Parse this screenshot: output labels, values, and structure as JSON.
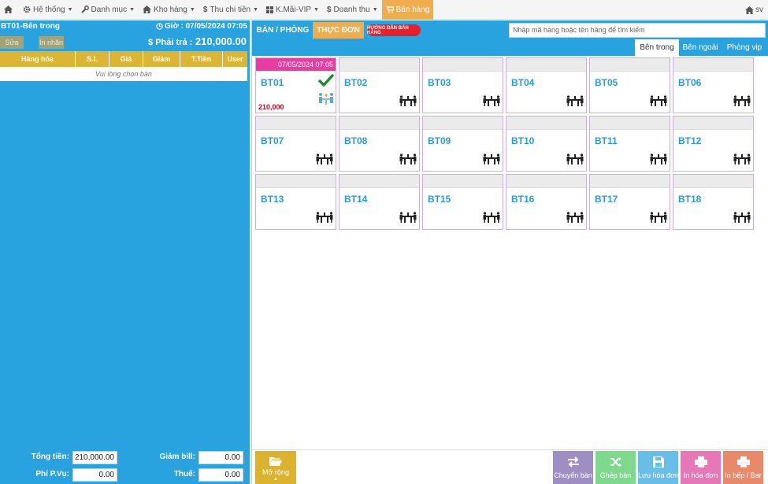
{
  "nav": {
    "home": "",
    "items": [
      {
        "label": "Hệ thống",
        "icon": "gear-icon"
      },
      {
        "label": "Danh mục",
        "icon": "wrench-icon"
      },
      {
        "label": "Kho hàng",
        "icon": "home-icon"
      },
      {
        "label": "Thu chi tiền",
        "icon": "dollar-icon"
      },
      {
        "label": "K.Mãi-VIP",
        "icon": "grid-icon"
      },
      {
        "label": "Doanh thu",
        "icon": "dollar-icon"
      }
    ],
    "active": "Bán hàng",
    "user": "sv"
  },
  "left": {
    "table_name": "BT01-Bên trong",
    "time_label": "Giờ : 07/05/2024 07:05",
    "btn_edit": "Sửa",
    "btn_print_label": "In nhãn",
    "pay_label": "$ Phải trả :",
    "pay_value": "210,000.00",
    "columns": [
      "Hàng hóa",
      "S.L",
      "Giá",
      "Giảm",
      "T.Tiền",
      "User"
    ],
    "empty_msg": "Vui lòng chọn bàn",
    "totals": {
      "total_label": "Tổng tiền:",
      "total_value": "210,000.00",
      "discount_label": "Giảm bill:",
      "discount_value": "0.00",
      "fee_label": "Phí P.Vụ:",
      "fee_value": "0.00",
      "tax_label": "Thuế:",
      "tax_value": "0.00"
    }
  },
  "right": {
    "tabs": {
      "tables": "BÀN / PHÒNG",
      "menu": "THỰC ĐƠN",
      "guide": "HƯỚNG DẪN BÁN HÀNG"
    },
    "search_placeholder": "Nhập mã hàng hoặc tên hàng để tìm kiếm",
    "areas": [
      "Bên trong",
      "Bên ngoài",
      "Phòng vip"
    ],
    "active_area": "Bên trong",
    "tables": [
      {
        "name": "BT01",
        "busy": true,
        "time": "07/05/2024 07:05",
        "amount": "210,000"
      },
      {
        "name": "BT02"
      },
      {
        "name": "BT03"
      },
      {
        "name": "BT04"
      },
      {
        "name": "BT05"
      },
      {
        "name": "BT06"
      },
      {
        "name": "BT07"
      },
      {
        "name": "BT08"
      },
      {
        "name": "BT09"
      },
      {
        "name": "BT10"
      },
      {
        "name": "BT11"
      },
      {
        "name": "BT12"
      },
      {
        "name": "BT13"
      },
      {
        "name": "BT14"
      },
      {
        "name": "BT15"
      },
      {
        "name": "BT16"
      },
      {
        "name": "BT17"
      },
      {
        "name": "BT18"
      }
    ]
  },
  "toolbar": {
    "expand": "Mở rộng",
    "actions": [
      {
        "label": "Chuyển bàn",
        "color": "#9f8ec4",
        "icon": "transfer-icon"
      },
      {
        "label": "Ghép bàn",
        "color": "#7fd98c",
        "icon": "shuffle-icon"
      },
      {
        "label": "Lưu hóa đơn",
        "color": "#67bfe7",
        "icon": "save-icon"
      },
      {
        "label": "In hóa đơn",
        "color": "#e778b8",
        "icon": "printer-icon"
      },
      {
        "label": "In bếp / Bar",
        "color": "#e8896a",
        "icon": "printer-icon"
      }
    ]
  },
  "colors": {
    "primary": "#29a3df",
    "accent": "#f0ad4e",
    "busy": "#e93ca3",
    "header": "#ddb534"
  }
}
